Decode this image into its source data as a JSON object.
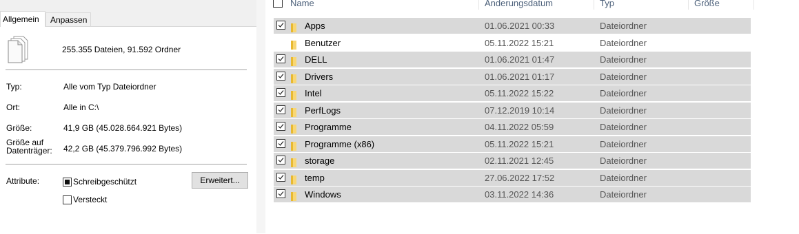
{
  "dialog": {
    "tabs": [
      {
        "label": "Allgemein"
      },
      {
        "label": "Anpassen"
      }
    ],
    "summary": "255.355 Dateien, 91.592 Ordner",
    "fields": {
      "type_label": "Typ:",
      "type_value": "Alle vom Typ Dateiordner",
      "location_label": "Ort:",
      "location_value": "Alle in C:\\",
      "size_label": "Größe:",
      "size_value": "41,9 GB (45.028.664.921 Bytes)",
      "size_on_disk_label_1": "Größe auf",
      "size_on_disk_label_2": "Datenträger:",
      "size_on_disk_value": "42,2 GB (45.379.796.992 Bytes)",
      "attributes_label": "Attribute:"
    },
    "attributes": {
      "readonly_label": "Schreibgeschützt",
      "readonly_state": "indeterminate",
      "hidden_label": "Versteckt",
      "hidden_checked": false,
      "advanced_button": "Erweitert..."
    }
  },
  "file_list": {
    "columns": {
      "name": "Name",
      "date": "Änderungsdatum",
      "type": "Typ",
      "size": "Größe"
    },
    "rows": [
      {
        "name": "Apps",
        "date": "01.06.2021 00:33",
        "type": "Dateiordner",
        "selected": true
      },
      {
        "name": "Benutzer",
        "date": "05.11.2022 15:21",
        "type": "Dateiordner",
        "selected": false
      },
      {
        "name": "DELL",
        "date": "01.06.2021 01:47",
        "type": "Dateiordner",
        "selected": true
      },
      {
        "name": "Drivers",
        "date": "01.06.2021 01:17",
        "type": "Dateiordner",
        "selected": true
      },
      {
        "name": "Intel",
        "date": "05.11.2022 15:22",
        "type": "Dateiordner",
        "selected": true
      },
      {
        "name": "PerfLogs",
        "date": "07.12.2019 10:14",
        "type": "Dateiordner",
        "selected": true
      },
      {
        "name": "Programme",
        "date": "04.11.2022 05:59",
        "type": "Dateiordner",
        "selected": true
      },
      {
        "name": "Programme (x86)",
        "date": "05.11.2022 15:21",
        "type": "Dateiordner",
        "selected": true
      },
      {
        "name": "storage",
        "date": "02.11.2021 12:45",
        "type": "Dateiordner",
        "selected": true
      },
      {
        "name": "temp",
        "date": "27.06.2022 17:52",
        "type": "Dateiordner",
        "selected": true
      },
      {
        "name": "Windows",
        "date": "03.11.2022 14:36",
        "type": "Dateiordner",
        "selected": true
      }
    ]
  },
  "colors": {
    "selection": "#d9d9d9",
    "folder": "#f8d775",
    "header_text": "#4c607a"
  }
}
